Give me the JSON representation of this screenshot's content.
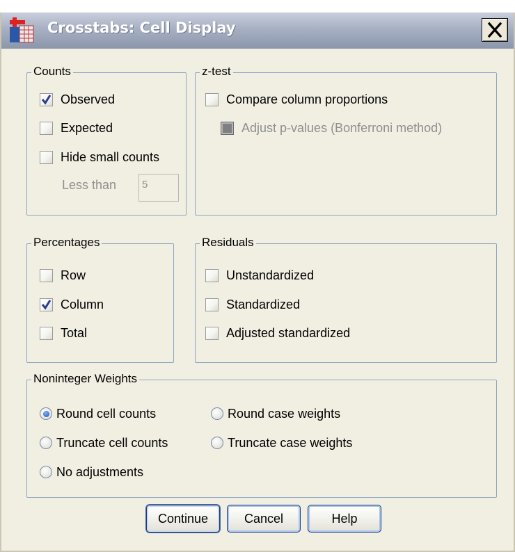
{
  "window": {
    "title": "Crosstabs: Cell Display",
    "close_label": "✕"
  },
  "counts": {
    "legend": "Counts",
    "observed": {
      "label": "Observed",
      "checked": true
    },
    "expected": {
      "label": "Expected",
      "checked": false
    },
    "hide_small": {
      "label": "Hide small counts",
      "checked": false
    },
    "less_than_label": "Less than",
    "less_than_value": "5"
  },
  "ztest": {
    "legend": "z-test",
    "compare": {
      "label": "Compare column proportions",
      "checked": false
    },
    "adjust": {
      "label": "Adjust p-values (Bonferroni method)",
      "checked": false,
      "disabled": true
    }
  },
  "percentages": {
    "legend": "Percentages",
    "row": {
      "label": "Row",
      "checked": false
    },
    "column": {
      "label": "Column",
      "checked": true
    },
    "total": {
      "label": "Total",
      "checked": false
    }
  },
  "residuals": {
    "legend": "Residuals",
    "unstandardized": {
      "label": "Unstandardized",
      "checked": false
    },
    "standardized": {
      "label": "Standardized",
      "checked": false
    },
    "adjusted": {
      "label": "Adjusted standardized",
      "checked": false
    }
  },
  "weights": {
    "legend": "Noninteger Weights",
    "options": {
      "round_cell": "Round cell counts",
      "round_case": "Round case weights",
      "truncate_cell": "Truncate cell counts",
      "truncate_case": "Truncate case weights",
      "no_adjust": "No adjustments"
    },
    "selected": "Round cell counts"
  },
  "buttons": {
    "continue": "Continue",
    "cancel": "Cancel",
    "help": "Help"
  },
  "colors": {
    "titlebar": "#a7b0c3",
    "dialog_bg": "#f1efe2",
    "group_border": "#8ea4c6",
    "check_mark": "#2b3d8c"
  }
}
